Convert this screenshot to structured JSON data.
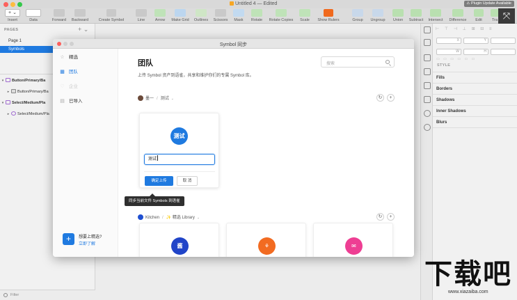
{
  "window": {
    "title": "Untitled 4 — Edited",
    "plugin_badge": "⚠ Plugin Update Available"
  },
  "toolbar": {
    "items": [
      {
        "label": "Insert"
      },
      {
        "label": "Data"
      },
      {
        "label": "Forward"
      },
      {
        "label": "Backward"
      },
      {
        "label": "Create Symbol"
      },
      {
        "label": "Line"
      },
      {
        "label": "Arrow"
      },
      {
        "label": "Make Grid"
      },
      {
        "label": "Outlines"
      },
      {
        "label": "Scissors"
      },
      {
        "label": "Mask"
      },
      {
        "label": "Rotate"
      },
      {
        "label": "Rotate Copies"
      },
      {
        "label": "Scale"
      },
      {
        "label": "Show Rulers"
      },
      {
        "label": "Group"
      },
      {
        "label": "Ungroup"
      },
      {
        "label": "Union"
      },
      {
        "label": "Subtract"
      },
      {
        "label": "Intersect"
      },
      {
        "label": "Difference"
      },
      {
        "label": "Edit"
      },
      {
        "label": "Tra"
      }
    ]
  },
  "pages_panel": {
    "header": "PAGES",
    "actions": "+ ⌄",
    "pages": [
      "Page 1",
      "Symbols"
    ],
    "active_page": "Symbols"
  },
  "layers": [
    {
      "name": "Button/Primary/Ba"
    },
    {
      "name": "Button/Primary/Ba"
    },
    {
      "name": "Select/Medium/Pla"
    },
    {
      "name": "Select/Medium/Pla"
    }
  ],
  "filter": {
    "label": "Filter"
  },
  "inspector": {
    "fields": [
      "X",
      "Y",
      "W",
      "H"
    ],
    "style_header": "STYLE",
    "sections": [
      "Fills",
      "Borders",
      "Shadows",
      "Inner Shadows",
      "Blurs"
    ]
  },
  "dialog": {
    "title": "Symbol 同步",
    "nav": [
      {
        "icon": "☆",
        "label": "精选"
      },
      {
        "icon": "▦",
        "label": "团队"
      },
      {
        "icon": "♡",
        "label": "企业"
      },
      {
        "icon": "▤",
        "label": "已导入"
      }
    ],
    "promo": {
      "title": "想要上精选?",
      "link": "立即了解"
    },
    "main": {
      "title": "团队",
      "description": "上传 Symbol 资产到语雀，共享和维护你们的专属 Symbol 库。",
      "search_placeholder": "搜索",
      "team_crumb": {
        "owner": "墨一",
        "library": "测试"
      },
      "card": {
        "badge": "测试",
        "name_value": "测试",
        "confirm": "确定上传",
        "cancel": "取 消"
      },
      "tooltip": "同步当前文件 Symbols 到语雀",
      "library_crumb": {
        "owner": "Kitchen",
        "library": "✨ 精选 Library"
      },
      "library_cards": [
        {
          "glyph": "酱",
          "color": "#2044c8"
        },
        {
          "glyph": "⚘",
          "color": "#f26b21"
        },
        {
          "glyph": "✉",
          "color": "#ee3e93"
        }
      ]
    }
  },
  "watermark": {
    "text": "下载吧",
    "url": "www.xiazaiba.com"
  },
  "colors": {
    "accent": "#1f7ae0",
    "selected_page": "#1f7ae0",
    "doc_icon": "#f7a623"
  }
}
